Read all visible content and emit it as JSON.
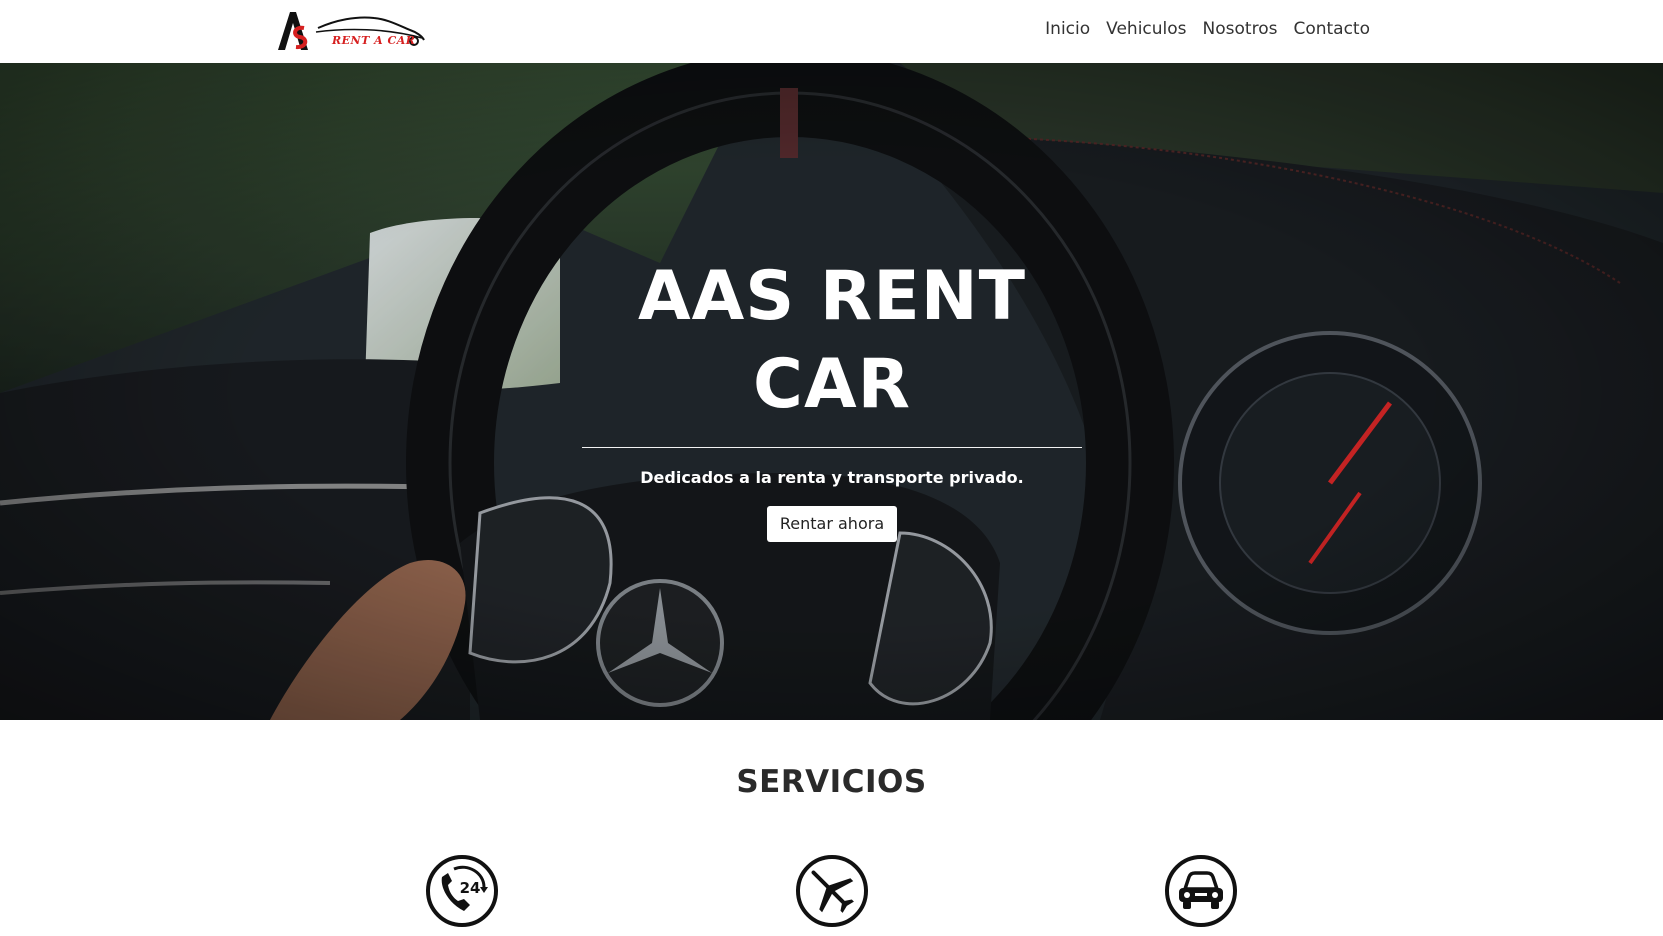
{
  "brand": {
    "logo_text": "RENT A CAR",
    "colors": {
      "red": "#d61f1f",
      "black": "#111111"
    }
  },
  "nav": {
    "items": [
      {
        "label": "Inicio"
      },
      {
        "label": "Vehiculos"
      },
      {
        "label": "Nosotros"
      },
      {
        "label": "Contacto"
      }
    ]
  },
  "hero": {
    "title_line1": "AAS RENT",
    "title_line2": "CAR",
    "subtitle": "Dedicados a la renta y transporte privado.",
    "cta_label": "Rentar ahora",
    "background": "car-interior-steering-wheel-photo"
  },
  "services": {
    "title": "SERVICIOS",
    "icons": [
      {
        "icon": "phone-24h-icon",
        "badge": "24"
      },
      {
        "icon": "airplane-icon"
      },
      {
        "icon": "car-icon"
      }
    ]
  }
}
